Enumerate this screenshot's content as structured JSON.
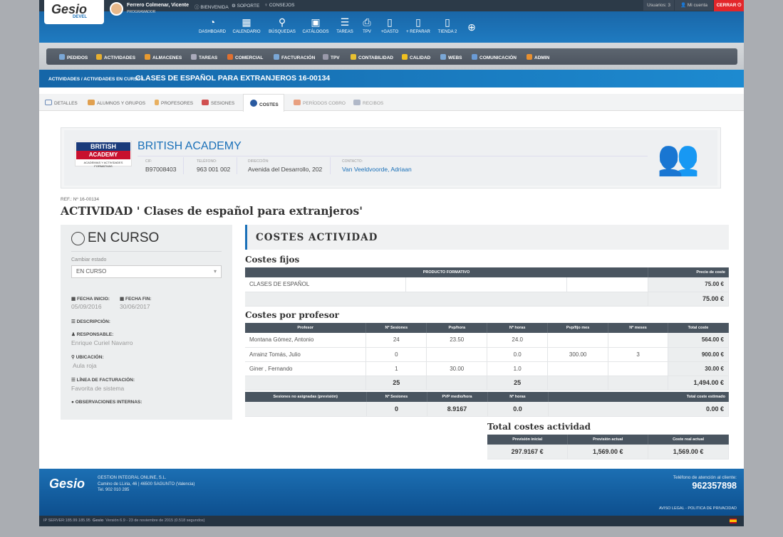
{
  "header": {
    "logo": "Gesio",
    "logo_sub": "DEVEL",
    "user_name": "Ferrero Colmenar, Vicente",
    "user_role": "PROGRAMADOR",
    "links": [
      "BIENVENIDA",
      "SOPORTE",
      "CONSEJOS"
    ],
    "usuarios": "Usuarios: 3",
    "mi_cuenta": "Mi cuenta",
    "cerrar": "CERRAR",
    "nav": [
      "DASHBOARD",
      "CALENDARIO",
      "BÚSQUEDAS",
      "CATÁLOGOS",
      "TAREAS",
      "TPV",
      "+GASTO",
      "+ REPARAR",
      "TIENDA 2"
    ]
  },
  "menu": [
    "PEDIDOS",
    "ACTIVIDADES",
    "ALMACENES",
    "TAREAS",
    "COMERCIAL",
    "FACTURACIÓN",
    "TPV",
    "CONTABILIDAD",
    "CALIDAD",
    "WEBS",
    "COMUNICACIÓN",
    "ADMIN"
  ],
  "breadcrumb": {
    "path": "ACTIVIDADES / ACTIVIDADES EN CURSO /",
    "current": "CLASES DE ESPAÑOL PARA EXTRANJEROS 16-00134"
  },
  "tabs": [
    "DETALLES",
    "ALUMNOS Y GRUPOS",
    "PROFESORES",
    "SESIONES",
    "COSTES",
    "PERÍODOS COBRO",
    "RECIBOS"
  ],
  "company": {
    "logo_top": "BRITISH",
    "logo_mid": "ACADEMY",
    "logo_sub": "ACADEMIAS Y ACTIVIDADES FORMATIVAS",
    "name": "BRITISH ACADEMY",
    "cif_label": "CIF:",
    "cif": "B97008403",
    "tel_label": "TELÉFONO:",
    "tel": "963 001 002",
    "dir_label": "DIRECCIÓN:",
    "dir": "Avenida del Desarrollo, 202",
    "contact_label": "CONTACTO:",
    "contact": "Van Veeldvoorde, Adriaan"
  },
  "ref": "REF.: Nº 16-00134",
  "title": "ACTIVIDAD ' Clases de español para extranjeros'",
  "left": {
    "estado": "EN CURSO",
    "cambiar_label": "Cambiar estado",
    "select_value": "EN CURSO",
    "fecha_inicio_label": "FECHA INICIO:",
    "fecha_inicio": "05/09/2016",
    "fecha_fin_label": "FECHA FIN:",
    "fecha_fin": "30/06/2017",
    "descripcion_label": "DESCRIPCIÓN:",
    "responsable_label": "RESPONSABLE:",
    "responsable": "Enrique Curiel Navarro",
    "ubicacion_label": "UBICACIÓN:",
    "ubicacion": "Aula roja",
    "linea_label": "LÍNEA DE FACTURACIÓN:",
    "linea": "Favorita de sistema",
    "observaciones_label": "OBSERVACIONES INTERNAS:"
  },
  "costes": {
    "heading": "COSTES ACTIVIDAD",
    "fijos_title": "Costes fijos",
    "fijos_headers": [
      "PRODUCTO FORMATIVO",
      "Precio de coste"
    ],
    "fijos_row": [
      "CLASES DE ESPAÑOL",
      "75.00 €"
    ],
    "fijos_total": "75.00 €",
    "prof_title": "Costes por profesor",
    "prof_headers": [
      "Profesor",
      "Nº Sesiones",
      "Pvp/hora",
      "Nº horas",
      "Pvp/fijo mes",
      "Nº meses",
      "Total coste"
    ],
    "prof_rows": [
      [
        "Montana Gómez, Antonio",
        "24",
        "23.50",
        "24.0",
        "",
        "",
        "564.00 €"
      ],
      [
        "Arrainz Tomás, Julio",
        "0",
        "",
        "0.0",
        "300.00",
        "3",
        "900.00 €"
      ],
      [
        "Giner , Fernando",
        "1",
        "30.00",
        "1.0",
        "",
        "",
        "30.00 €"
      ]
    ],
    "prof_totals": {
      "sesiones": "25",
      "horas": "25",
      "total": "1,494.00 €"
    },
    "noasig_headers": [
      "Sesiones no asignadas (previsión)",
      "Nº Sesiones",
      "PVP medio/hora",
      "Nº horas",
      "Total coste estimado"
    ],
    "noasig_row": [
      "",
      "0",
      "8.9167",
      "0.0",
      "0.00 €"
    ],
    "total_title": "Total costes actividad",
    "total_headers": [
      "Previsión inicial",
      "Previsión actual",
      "Coste real actual"
    ],
    "total_row": [
      "297.9167 €",
      "1,569.00 €",
      "1,569.00 €"
    ]
  },
  "footer": {
    "logo": "Gesio",
    "line1": "GESTION INTEGRAL ONLINE, S.L.",
    "line2": "Camino de LLiria, 46 | 46500 SAGUNTO (Valencia)",
    "line3": "Tel. 902 010 285",
    "phone_label": "Teléfono de atención al cliente:",
    "phone": "962357898",
    "legal": "AVISO LEGAL - POLITICA DE PRIVACIDAD",
    "server": "IP SERVER:185.99.185.95",
    "version": "Versión 6.9 - 23 de noviembre de 2015 (0.518 segundos)"
  }
}
